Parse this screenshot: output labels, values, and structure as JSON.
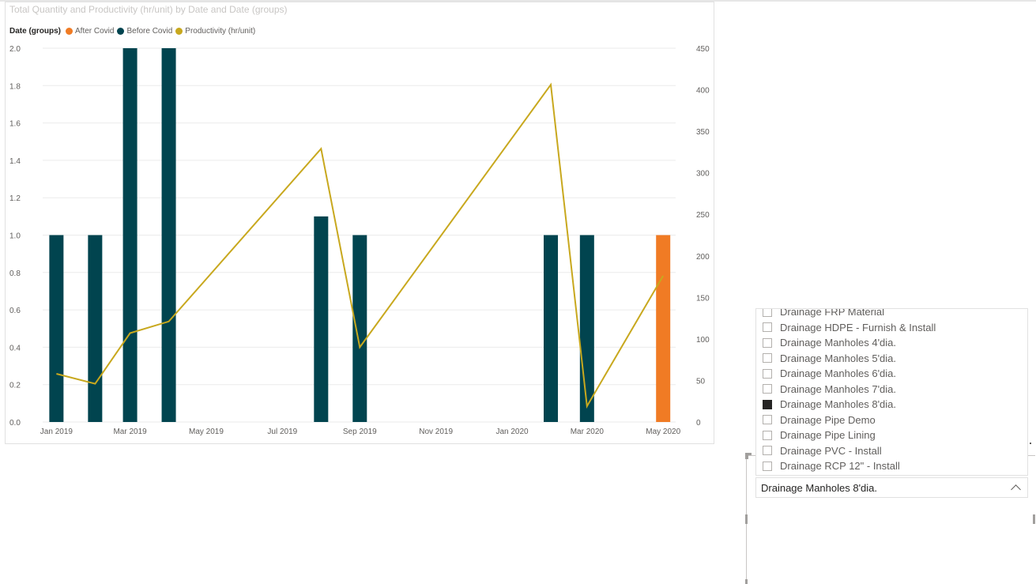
{
  "chart": {
    "title": "Total Quantity and Productivity (hr/unit) by Date and Date (groups)",
    "legend_title": "Date (groups)",
    "legend": [
      {
        "name": "After Covid",
        "color": "#f07b24"
      },
      {
        "name": "Before Covid",
        "color": "#01444f"
      },
      {
        "name": "Productivity (hr/unit)",
        "color": "#c8a81e"
      }
    ]
  },
  "chart_data": {
    "type": "bar",
    "x_ticks": [
      "Jan 2019",
      "Mar 2019",
      "May 2019",
      "Jul 2019",
      "Sep 2019",
      "Nov 2019",
      "Jan 2020",
      "Mar 2020",
      "May 2020"
    ],
    "y_ticks": [
      "0.0",
      "0.2",
      "0.4",
      "0.6",
      "0.8",
      "1.0",
      "1.2",
      "1.4",
      "1.6",
      "1.8",
      "2.0"
    ],
    "y2_ticks": [
      "0",
      "50",
      "100",
      "150",
      "200",
      "250",
      "300",
      "350",
      "400",
      "450"
    ],
    "ylim": [
      0,
      2.0
    ],
    "y2lim": [
      0,
      450
    ],
    "series": [
      {
        "name": "Before Covid",
        "color": "#01444f",
        "type": "bar",
        "points": [
          [
            "2019-01-01",
            1.0
          ],
          [
            "2019-02-01",
            1.0
          ],
          [
            "2019-03-01",
            2.0
          ],
          [
            "2019-04-01",
            2.0
          ],
          [
            "2019-08-01",
            1.1
          ],
          [
            "2019-09-01",
            1.0
          ],
          [
            "2020-02-01",
            1.0
          ],
          [
            "2020-03-01",
            1.0
          ]
        ]
      },
      {
        "name": "After Covid",
        "color": "#f07b24",
        "type": "bar",
        "points": [
          [
            "2020-05-01",
            1.0
          ]
        ]
      },
      {
        "name": "Productivity (hr/unit)",
        "color": "#c8a81e",
        "type": "line",
        "axis": "right",
        "points": [
          [
            "2019-01-01",
            58
          ],
          [
            "2019-02-01",
            46
          ],
          [
            "2019-03-01",
            107
          ],
          [
            "2019-04-01",
            121
          ],
          [
            "2019-08-01",
            329
          ],
          [
            "2019-09-01",
            90
          ],
          [
            "2020-02-01",
            406
          ],
          [
            "2020-03-01",
            19
          ],
          [
            "2020-05-01",
            176
          ]
        ]
      }
    ]
  },
  "slicer": {
    "items": [
      {
        "label": "Drainage FRP Material",
        "checked": false
      },
      {
        "label": "Drainage HDPE - Furnish & Install",
        "checked": false
      },
      {
        "label": "Drainage Manholes 4'dia.",
        "checked": false
      },
      {
        "label": "Drainage Manholes 5'dia.",
        "checked": false
      },
      {
        "label": "Drainage Manholes 6'dia.",
        "checked": false
      },
      {
        "label": "Drainage Manholes 7'dia.",
        "checked": false
      },
      {
        "label": "Drainage Manholes 8'dia.",
        "checked": true
      },
      {
        "label": "Drainage Pipe Demo",
        "checked": false
      },
      {
        "label": "Drainage Pipe Lining",
        "checked": false
      },
      {
        "label": "Drainage PVC - Install",
        "checked": false
      },
      {
        "label": "Drainage RCP 12\" - Install",
        "checked": false
      }
    ],
    "selected": "Drainage Manholes 8'dia."
  }
}
